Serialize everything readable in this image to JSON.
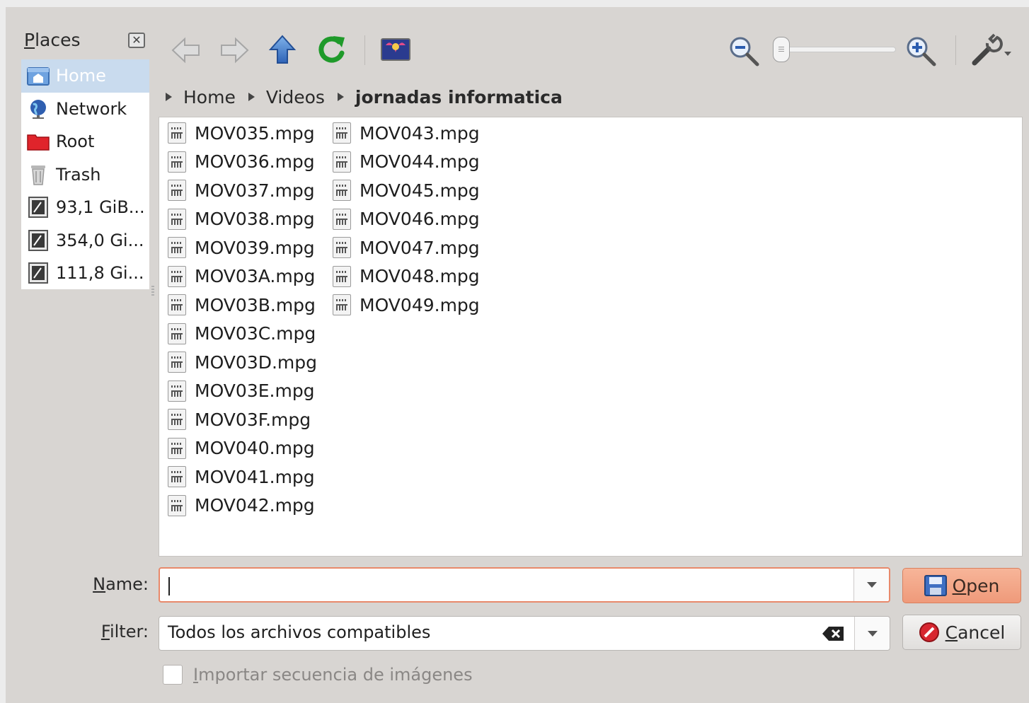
{
  "places": {
    "title": "Places",
    "items": [
      {
        "label": "Home",
        "icon": "home-icon",
        "selected": true
      },
      {
        "label": "Network",
        "icon": "network-globe-icon"
      },
      {
        "label": "Root",
        "icon": "root-folder-icon"
      },
      {
        "label": "Trash",
        "icon": "trash-icon"
      },
      {
        "label": "93,1 GiB...",
        "icon": "drive-icon"
      },
      {
        "label": "354,0 Gi...",
        "icon": "drive-icon"
      },
      {
        "label": "111,8 Gi...",
        "icon": "drive-icon"
      }
    ]
  },
  "toolbar": {
    "back": "back-arrow-icon",
    "forward": "forward-arrow-icon",
    "up": "up-arrow-icon",
    "reload": "reload-icon",
    "preview": "preview-icon",
    "zoom_out": "zoom-out-icon",
    "zoom_in": "zoom-in-icon",
    "zoom_level": 0,
    "options": "wrench-options-icon"
  },
  "breadcrumb": [
    "Home",
    "Videos",
    "jornadas informatica"
  ],
  "files": {
    "column1": [
      "MOV035.mpg",
      "MOV036.mpg",
      "MOV037.mpg",
      "MOV038.mpg",
      "MOV039.mpg",
      "MOV03A.mpg",
      "MOV03B.mpg",
      "MOV03C.mpg",
      "MOV03D.mpg",
      "MOV03E.mpg",
      "MOV03F.mpg",
      "MOV040.mpg",
      "MOV041.mpg",
      "MOV042.mpg"
    ],
    "column2": [
      "MOV043.mpg",
      "MOV044.mpg",
      "MOV045.mpg",
      "MOV046.mpg",
      "MOV047.mpg",
      "MOV048.mpg",
      "MOV049.mpg"
    ]
  },
  "form": {
    "name_label": "Name:",
    "name_value": "",
    "filter_label": "Filter:",
    "filter_value": "Todos los archivos compatibles",
    "open_label": "Open",
    "cancel_label": "Cancel",
    "checkbox_label": "Importar secuencia de imágenes",
    "checkbox_checked": false
  },
  "colors": {
    "selection": "#c9dbee",
    "focus_border": "#e8896b",
    "primary_button": "#ef9a7a"
  }
}
